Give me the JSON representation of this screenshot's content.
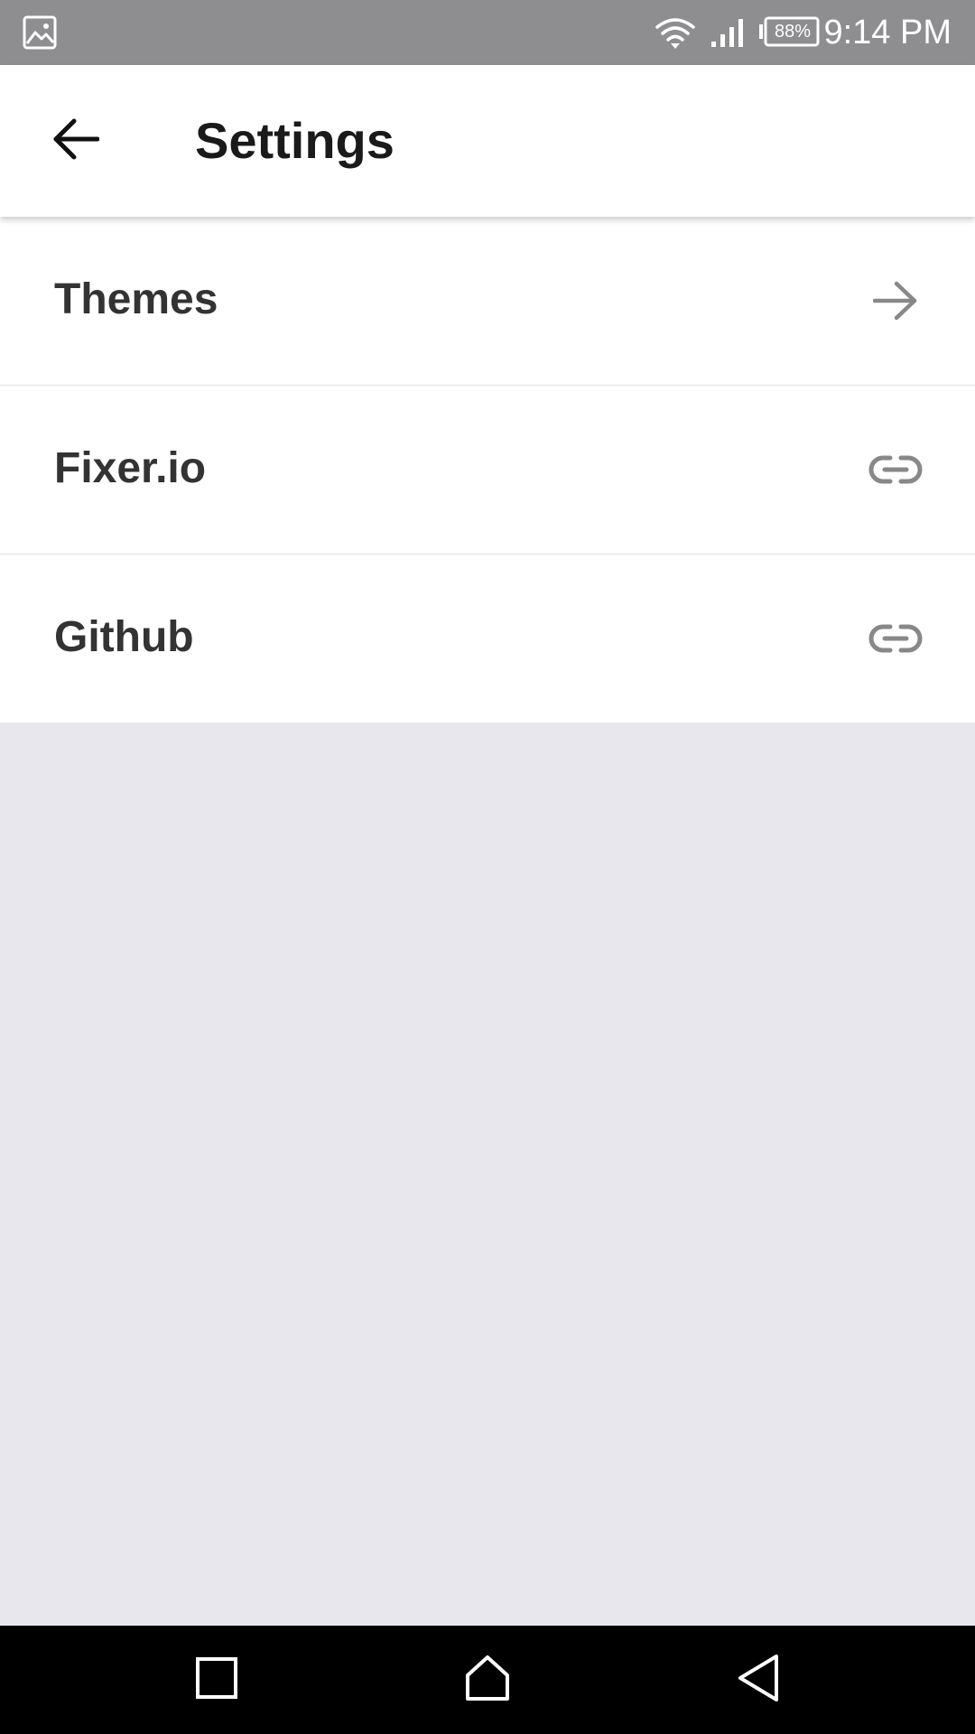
{
  "status_bar": {
    "notification_icon": "gallery-icon",
    "wifi_icon": "wifi-icon",
    "signal_icon": "signal-icon",
    "battery_level": "88%",
    "time": "9:14 PM"
  },
  "app_bar": {
    "back_icon": "arrow-back-icon",
    "title": "Settings"
  },
  "settings": {
    "items": [
      {
        "label": "Themes",
        "icon": "arrow-forward-icon"
      },
      {
        "label": "Fixer.io",
        "icon": "link-icon"
      },
      {
        "label": "Github",
        "icon": "link-icon"
      }
    ]
  },
  "nav_bar": {
    "recents_icon": "square-recents-icon",
    "home_icon": "home-icon",
    "back_icon": "triangle-back-icon"
  },
  "colors": {
    "status_bar_bg": "#8e8e90",
    "app_bar_bg": "#ffffff",
    "page_bg": "#e8e7ed",
    "label_text": "#333333",
    "icon_gray": "#888888",
    "nav_bar_bg": "#000000"
  }
}
